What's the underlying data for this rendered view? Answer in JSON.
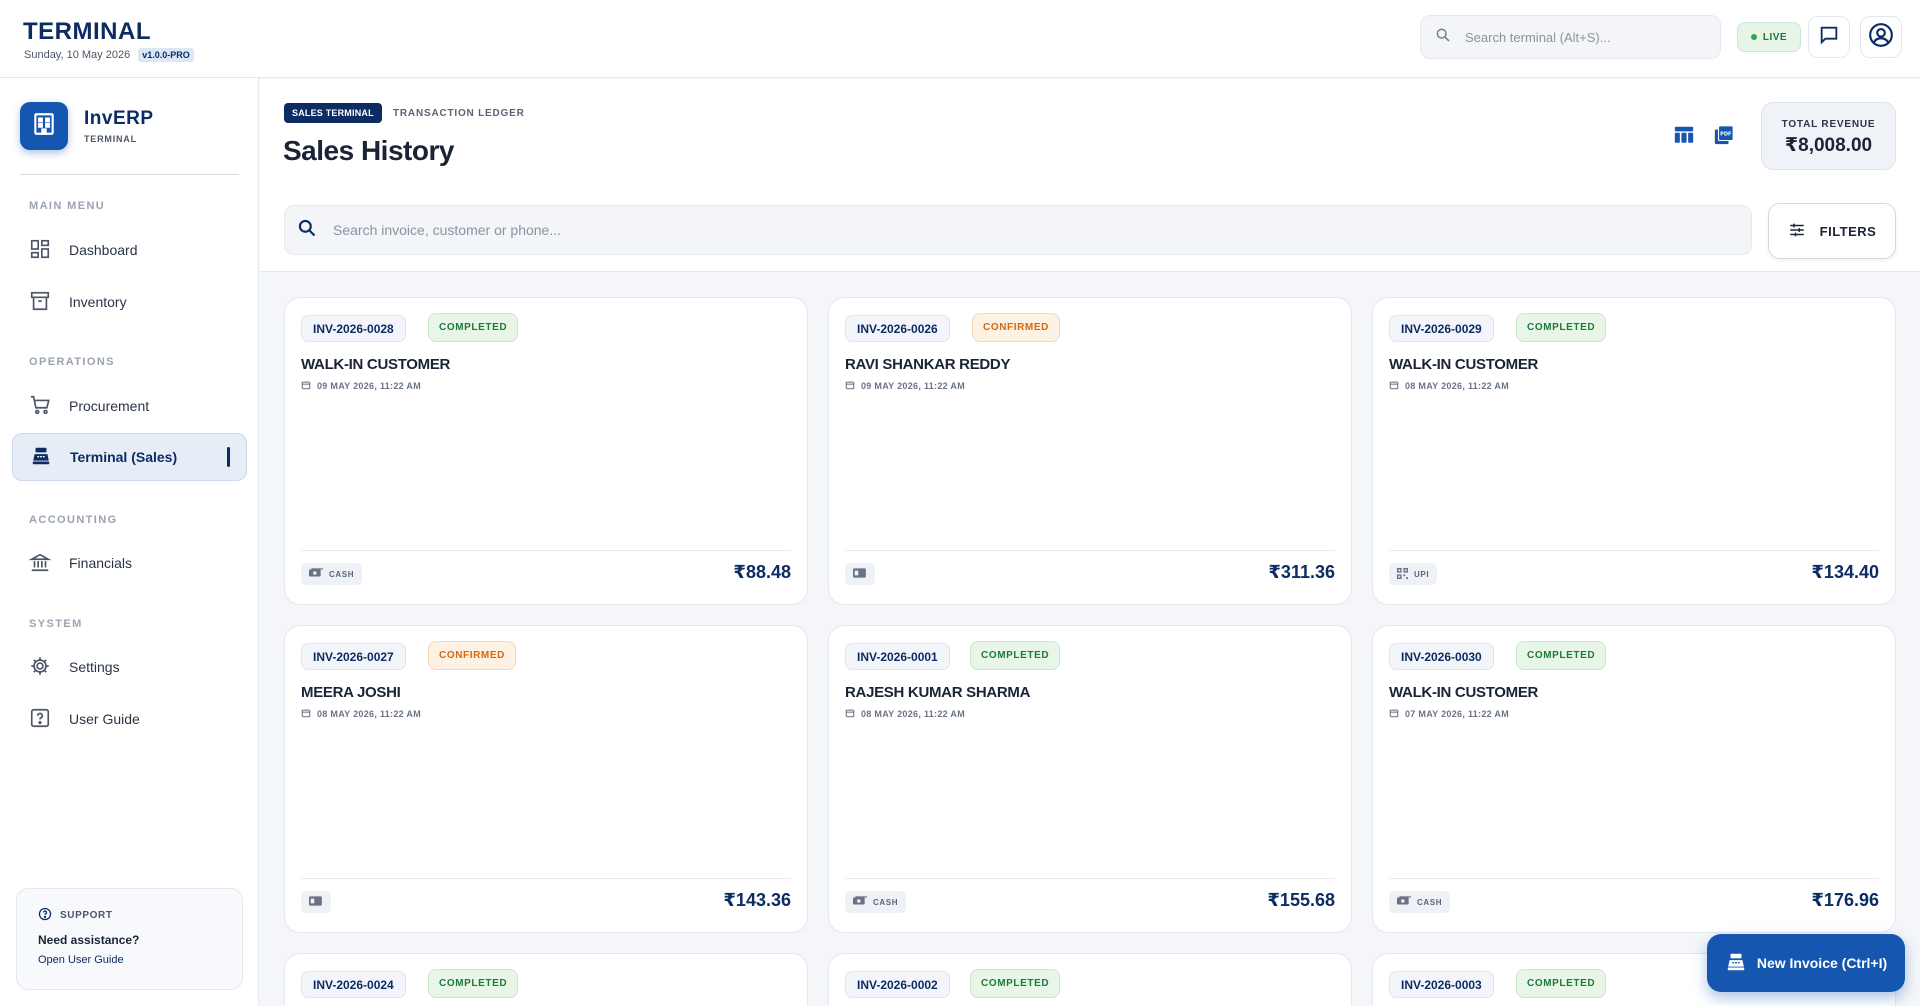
{
  "topbar": {
    "title": "TERMINAL",
    "date": "Sunday, 10 May 2026",
    "version": "v1.0.0-PRO",
    "search_placeholder": "Search terminal (Alt+S)...",
    "live_label": "LIVE"
  },
  "sidebar": {
    "brand_name": "InvERP",
    "brand_sub": "TERMINAL",
    "sections": {
      "main_menu": "MAIN MENU",
      "operations": "OPERATIONS",
      "accounting": "ACCOUNTING",
      "system": "SYSTEM"
    },
    "items": {
      "dashboard": "Dashboard",
      "inventory": "Inventory",
      "procurement": "Procurement",
      "terminal_sales": "Terminal (Sales)",
      "financials": "Financials",
      "settings": "Settings",
      "user_guide": "User Guide"
    },
    "support": {
      "label": "SUPPORT",
      "title": "Need assistance?",
      "link": "Open User Guide"
    }
  },
  "header": {
    "pill": "SALES TERMINAL",
    "breadcrumb": "TRANSACTION LEDGER",
    "title": "Sales History",
    "revenue_label": "TOTAL REVENUE",
    "revenue_value": "₹8,008.00",
    "search_placeholder": "Search invoice, customer or phone...",
    "filters_label": "FILTERS"
  },
  "cards": [
    {
      "invoice": "INV-2026-0028",
      "status": "COMPLETED",
      "customer": "WALK-IN CUSTOMER",
      "date": "09 MAY 2026, 11:22 AM",
      "payment": "CASH",
      "amount": "₹88.48"
    },
    {
      "invoice": "INV-2026-0026",
      "status": "CONFIRMED",
      "customer": "RAVI SHANKAR REDDY",
      "date": "09 MAY 2026, 11:22 AM",
      "payment": "",
      "amount": "₹311.36"
    },
    {
      "invoice": "INV-2026-0029",
      "status": "COMPLETED",
      "customer": "WALK-IN CUSTOMER",
      "date": "08 MAY 2026, 11:22 AM",
      "payment": "UPI",
      "amount": "₹134.40"
    },
    {
      "invoice": "INV-2026-0027",
      "status": "CONFIRMED",
      "customer": "MEERA JOSHI",
      "date": "08 MAY 2026, 11:22 AM",
      "payment": "",
      "amount": "₹143.36"
    },
    {
      "invoice": "INV-2026-0001",
      "status": "COMPLETED",
      "customer": "RAJESH KUMAR SHARMA",
      "date": "08 MAY 2026, 11:22 AM",
      "payment": "CASH",
      "amount": "₹155.68"
    },
    {
      "invoice": "INV-2026-0030",
      "status": "COMPLETED",
      "customer": "WALK-IN CUSTOMER",
      "date": "07 MAY 2026, 11:22 AM",
      "payment": "CASH",
      "amount": "₹176.96"
    },
    {
      "invoice": "INV-2026-0024",
      "status": "COMPLETED"
    },
    {
      "invoice": "INV-2026-0002",
      "status": "COMPLETED"
    },
    {
      "invoice": "INV-2026-0003",
      "status": "COMPLETED"
    }
  ],
  "fab_label": "New Invoice (Ctrl+I)",
  "colors": {
    "primary": "#0d2c64",
    "accent": "#1557b0",
    "completed": "#1f7a35",
    "confirmed": "#d2690f"
  }
}
